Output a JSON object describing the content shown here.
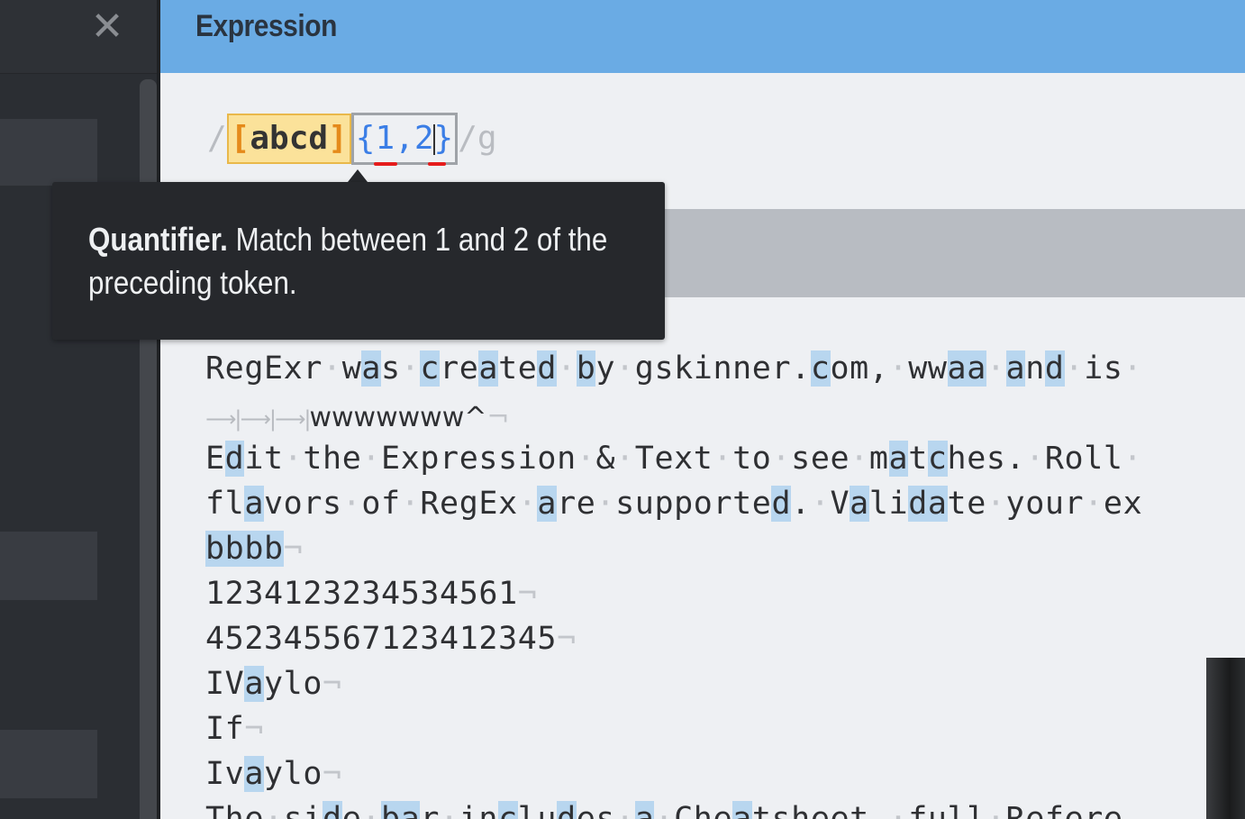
{
  "header": {
    "title": "Expression"
  },
  "sidebar": {
    "close_label": "✕"
  },
  "expression": {
    "open_delim": "/",
    "set_open": "[",
    "set_body": "abcd",
    "set_close": "]",
    "quant_open": "{",
    "quant_min": "1",
    "quant_comma": ",",
    "quant_max": "2",
    "quant_close": "}",
    "close_delim": "/",
    "flags": "g"
  },
  "tooltip": {
    "title": "Quantifier.",
    "body": "Match between 1 and 2 of the preceding token."
  },
  "text_lines": {
    "l1_tabs": "⟶|⟶|⟶|",
    "l1_tab_text": "wwwwwww^",
    "l5": "bbbb",
    "l6": "1234123234534561",
    "l7": "45234556712341234 5",
    "l8": "IVaylo",
    "l9": "If",
    "l10": "Ivaylo"
  },
  "colors": {
    "header_bg": "#6aabe4",
    "sidebar_bg": "#2b2e33",
    "match_highlight": "#b8d6ef",
    "set_highlight": "#fbe29a",
    "quantifier_text": "#3b7ee6",
    "tooltip_bg": "#26282c"
  }
}
